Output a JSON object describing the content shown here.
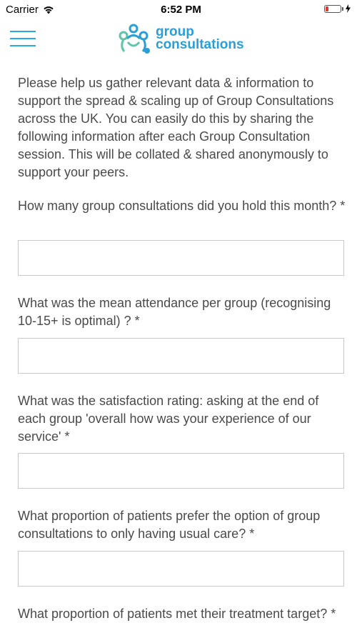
{
  "status_bar": {
    "carrier": "Carrier",
    "time": "6:52 PM",
    "battery_level": 0.2,
    "battery_color": "#e8352f"
  },
  "header": {
    "menu_icon": "hamburger-menu-icon",
    "logo_line1": "group",
    "logo_line2": "consultations",
    "brand_color": "#2a9fd6"
  },
  "intro": "Please help us gather relevant data & information to support the spread & scaling up of Group Consultations across the UK.  You can easily do this by sharing the following information after each Group Consultation session.  This will be collated & shared anonymously to support your peers.",
  "questions": [
    {
      "label": "How many group consultations did you hold this month? *",
      "value": ""
    },
    {
      "label": "What was the mean attendance per group (recognising 10-15+ is optimal) ? *",
      "value": ""
    },
    {
      "label": "What was the satisfaction rating: asking at the end of each group 'overall how was your experience of our service' *",
      "value": ""
    },
    {
      "label": "What proportion of patients prefer the option of group consultations to only having usual care? *",
      "value": ""
    },
    {
      "label": "What proportion of patients met their treatment target? *"
    }
  ]
}
